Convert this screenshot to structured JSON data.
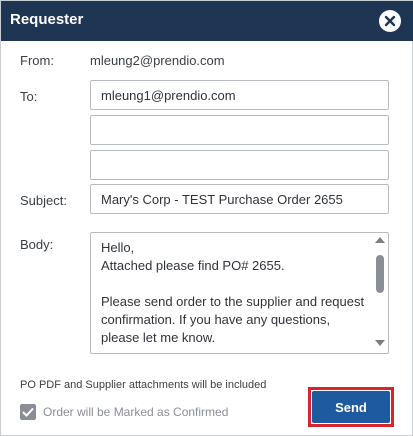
{
  "dialog": {
    "title": "Requester",
    "close_icon": "close-icon"
  },
  "from": {
    "label": "From:",
    "value": "mleung2@prendio.com"
  },
  "to": {
    "label": "To:",
    "fields": [
      "mleung1@prendio.com",
      "",
      ""
    ]
  },
  "subject": {
    "label": "Subject:",
    "value": "Mary's Corp - TEST Purchase Order 2655"
  },
  "body": {
    "label": "Body:",
    "text": "Hello,\nAttached please find PO# 2655.\n\nPlease send order to the supplier and request confirmation. If you have any questions, please let me know.\n\nThanks,"
  },
  "note": "PO PDF and Supplier attachments will be included",
  "confirm_checkbox": {
    "label": "Order will be Marked as Confirmed",
    "checked": true
  },
  "send_button": {
    "label": "Send"
  },
  "colors": {
    "titlebar": "#1f3554",
    "send": "#1e5aa0",
    "highlight": "#d9232d"
  }
}
